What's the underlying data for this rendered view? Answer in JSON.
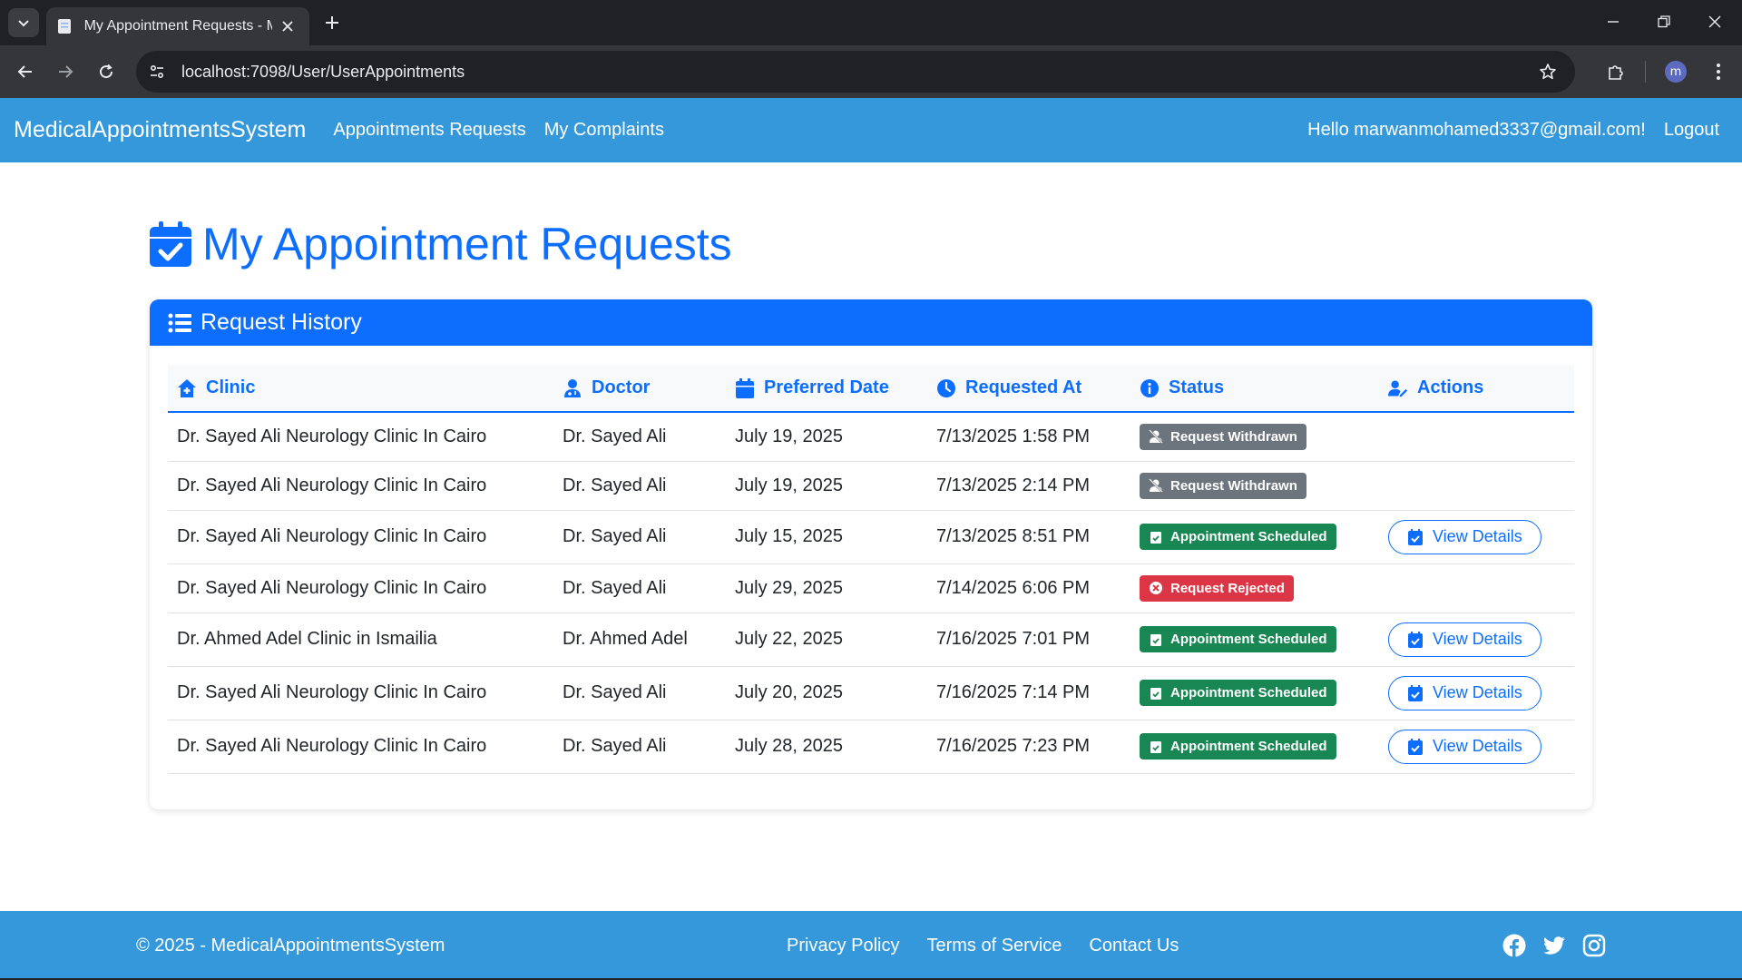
{
  "browser": {
    "tab_title": "My Appointment Requests - Me",
    "url": "localhost:7098/User/UserAppointments",
    "profile_initial": "m"
  },
  "navbar": {
    "brand": "MedicalAppointmentsSystem",
    "links": [
      "Appointments Requests",
      "My Complaints"
    ],
    "greeting": "Hello marwanmohamed3337@gmail.com!",
    "logout": "Logout",
    "bg_color": "#3498db"
  },
  "page": {
    "title": "My Appointment Requests",
    "accent_color": "#0d6efd"
  },
  "card": {
    "header": "Request History"
  },
  "table": {
    "columns": [
      "Clinic",
      "Doctor",
      "Preferred Date",
      "Requested At",
      "Status",
      "Actions"
    ],
    "column_icons": [
      "clinic-icon",
      "doctor-icon",
      "calendar-icon",
      "clock-icon",
      "info-icon",
      "user-edit-icon"
    ],
    "rows": [
      {
        "clinic": "Dr. Sayed Ali Neurology Clinic In Cairo",
        "doctor": "Dr. Sayed Ali",
        "preferred": "July 19, 2025",
        "requested": "7/13/2025 1:58 PM",
        "status": "Request Withdrawn",
        "status_type": "withdrawn",
        "action": ""
      },
      {
        "clinic": "Dr. Sayed Ali Neurology Clinic In Cairo",
        "doctor": "Dr. Sayed Ali",
        "preferred": "July 19, 2025",
        "requested": "7/13/2025 2:14 PM",
        "status": "Request Withdrawn",
        "status_type": "withdrawn",
        "action": ""
      },
      {
        "clinic": "Dr. Sayed Ali Neurology Clinic In Cairo",
        "doctor": "Dr. Sayed Ali",
        "preferred": "July 15, 2025",
        "requested": "7/13/2025 8:51 PM",
        "status": "Appointment Scheduled",
        "status_type": "scheduled",
        "action": "View Details"
      },
      {
        "clinic": "Dr. Sayed Ali Neurology Clinic In Cairo",
        "doctor": "Dr. Sayed Ali",
        "preferred": "July 29, 2025",
        "requested": "7/14/2025 6:06 PM",
        "status": "Request Rejected",
        "status_type": "rejected",
        "action": ""
      },
      {
        "clinic": "Dr. Ahmed Adel Clinic in Ismailia",
        "doctor": "Dr. Ahmed Adel",
        "preferred": "July 22, 2025",
        "requested": "7/16/2025 7:01 PM",
        "status": "Appointment Scheduled",
        "status_type": "scheduled",
        "action": "View Details"
      },
      {
        "clinic": "Dr. Sayed Ali Neurology Clinic In Cairo",
        "doctor": "Dr. Sayed Ali",
        "preferred": "July 20, 2025",
        "requested": "7/16/2025 7:14 PM",
        "status": "Appointment Scheduled",
        "status_type": "scheduled",
        "action": "View Details"
      },
      {
        "clinic": "Dr. Sayed Ali Neurology Clinic In Cairo",
        "doctor": "Dr. Sayed Ali",
        "preferred": "July 28, 2025",
        "requested": "7/16/2025 7:23 PM",
        "status": "Appointment Scheduled",
        "status_type": "scheduled",
        "action": "View Details"
      }
    ],
    "status_colors": {
      "withdrawn": "#6c757d",
      "scheduled": "#198754",
      "rejected": "#dc3545"
    }
  },
  "footer": {
    "copyright": "© 2025 - MedicalAppointmentsSystem",
    "links": [
      "Privacy Policy",
      "Terms of Service",
      "Contact Us"
    ],
    "social_icons": [
      "facebook-icon",
      "twitter-icon",
      "instagram-icon"
    ]
  }
}
